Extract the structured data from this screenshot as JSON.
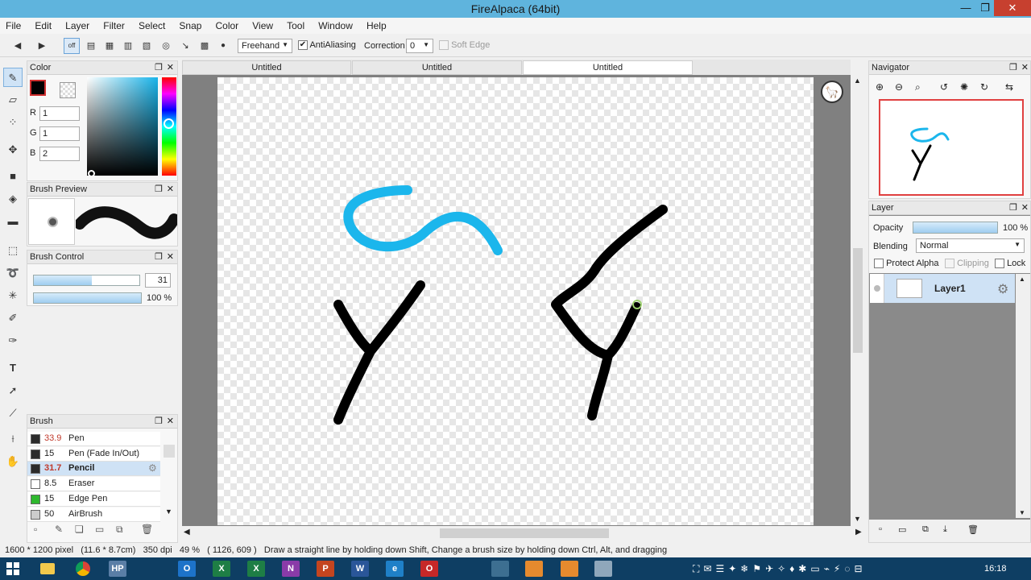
{
  "window": {
    "title": "FireAlpaca (64bit)",
    "minimize": "—",
    "maximize": "❐",
    "close": "✕"
  },
  "menu": [
    "File",
    "Edit",
    "Layer",
    "Filter",
    "Select",
    "Snap",
    "Color",
    "View",
    "Tool",
    "Window",
    "Help"
  ],
  "toolbar": {
    "off_label": "off",
    "brush_mode": "Freehand",
    "antialiasing_label": "AntiAliasing",
    "antialiasing_checked": "✔",
    "correction_label": "Correction",
    "correction_value": "0",
    "soft_edge_label": "Soft Edge"
  },
  "tabs": [
    "Untitled",
    "Untitled",
    "Untitled"
  ],
  "color_panel": {
    "title": "Color",
    "r_label": "R",
    "r_value": "1",
    "g_label": "G",
    "g_value": "1",
    "b_label": "B",
    "b_value": "2",
    "fg_color": "#010102"
  },
  "brush_preview": {
    "title": "Brush Preview"
  },
  "brush_control": {
    "title": "Brush Control",
    "size_value": "31",
    "opacity_value": "100 %",
    "size_fraction": 0.55,
    "opacity_fraction": 1.0
  },
  "brush_panel": {
    "title": "Brush",
    "items": [
      {
        "size": "33.9",
        "name": "Pen",
        "swatch": "#2b2b2b",
        "size_color": "#c0392b"
      },
      {
        "size": "15",
        "name": "Pen (Fade In/Out)",
        "swatch": "#2b2b2b",
        "size_color": "#222222"
      },
      {
        "size": "31.7",
        "name": "Pencil",
        "swatch": "#2b2b2b",
        "size_color": "#c0392b"
      },
      {
        "size": "8.5",
        "name": "Eraser",
        "swatch": "#ffffff",
        "size_color": "#222222"
      },
      {
        "size": "15",
        "name": "Edge Pen",
        "swatch": "#2eb82e",
        "size_color": "#222222"
      },
      {
        "size": "50",
        "name": "AirBrush",
        "swatch": "#cccccc",
        "size_color": "#222222"
      }
    ]
  },
  "navigator": {
    "title": "Navigator"
  },
  "layer_panel": {
    "title": "Layer",
    "opacity_label": "Opacity",
    "opacity_value": "100 %",
    "blending_label": "Blending",
    "blending_value": "Normal",
    "protect_alpha_label": "Protect Alpha",
    "clipping_label": "Clipping",
    "lock_label": "Lock",
    "layer_name": "Layer1"
  },
  "status": {
    "size": "1600 * 1200 pixel",
    "physical": "(11.6 * 8.7cm)",
    "dpi": "350 dpi",
    "zoom": "49 %",
    "cursor": "( 1126, 609 )",
    "hint": "Draw a straight line by holding down Shift, Change a brush size by holding down Ctrl, Alt, and dragging"
  },
  "taskbar": {
    "clock": "16:18",
    "apps": [
      {
        "label": "HP",
        "color": "#5a7ea6"
      },
      {
        "label": "O",
        "color": "#1d73c9"
      },
      {
        "label": "X",
        "color": "#1e7e45"
      },
      {
        "label": "X",
        "color": "#1e7e45"
      },
      {
        "label": "N",
        "color": "#8a3ba8"
      },
      {
        "label": "P",
        "color": "#c4451f"
      },
      {
        "label": "W",
        "color": "#2a5699"
      },
      {
        "label": "e",
        "color": "#1f80c8"
      },
      {
        "label": "O",
        "color": "#c62828"
      },
      {
        "label": "",
        "color": "#3d6f91"
      },
      {
        "label": "",
        "color": "#e68a2e"
      },
      {
        "label": "",
        "color": "#e68a2e"
      },
      {
        "label": "",
        "color": "#8fa7bb"
      }
    ]
  }
}
